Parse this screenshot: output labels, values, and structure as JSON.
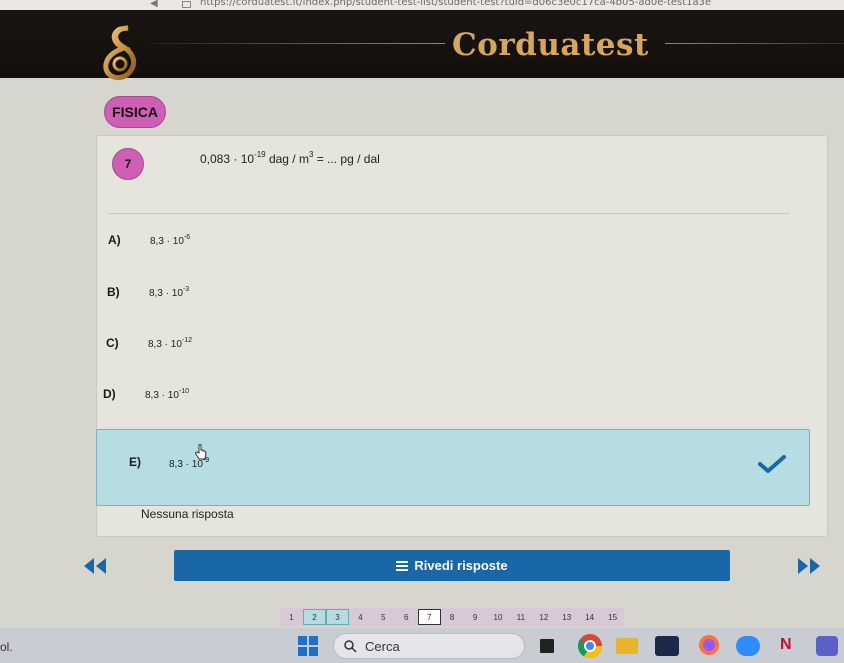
{
  "browser": {
    "url": "https://corduatest.it/index.php/student-test-list/student-test?tuid=d06c3e0c17ca-4b05-ad0e-test1a3e"
  },
  "header": {
    "brand": "Corduatest",
    "logo_icon": "gold-swirl-logo-icon"
  },
  "subject": {
    "label": "FISICA"
  },
  "question": {
    "number": "7",
    "text_prefix": "0,083 · 10",
    "text_exp": "-19",
    "text_suffix": " dag / m",
    "text_exp2": "3",
    "text_tail": " = ... pg / dal"
  },
  "options": [
    {
      "letter": "A)",
      "mantissa": "8,3 · 10",
      "exp": "-6"
    },
    {
      "letter": "B)",
      "mantissa": "8,3 · 10",
      "exp": "-3"
    },
    {
      "letter": "C)",
      "mantissa": "8,3 · 10",
      "exp": "-12"
    },
    {
      "letter": "D)",
      "mantissa": "8,3 · 10",
      "exp": "-10"
    },
    {
      "letter": "E)",
      "mantissa": "8,3 · 10",
      "exp": "-9",
      "selected": true
    }
  ],
  "no_answer": {
    "label": "Nessuna risposta"
  },
  "navigation": {
    "prev_icon": "double-chevron-left-icon",
    "next_icon": "double-chevron-right-icon",
    "review_label": "Rivedi risposte",
    "review_icon": "list-icon"
  },
  "pager": {
    "pages": [
      "1",
      "2",
      "3",
      "4",
      "5",
      "6",
      "7",
      "8",
      "9",
      "10",
      "11",
      "12",
      "13",
      "14",
      "15"
    ],
    "current": "7",
    "answered": [
      "2",
      "3"
    ]
  },
  "taskbar": {
    "left_text": "ol.",
    "search_placeholder": "Cerca",
    "netflix_letter": "N"
  },
  "colors": {
    "header_bg": "#120f0c",
    "brand_gold": "#d6a65a",
    "pill_magenta": "#cf5fb4",
    "selected_bg": "#b5dde2",
    "check_blue": "#1a67a8",
    "review_btn": "#1a67a8"
  }
}
